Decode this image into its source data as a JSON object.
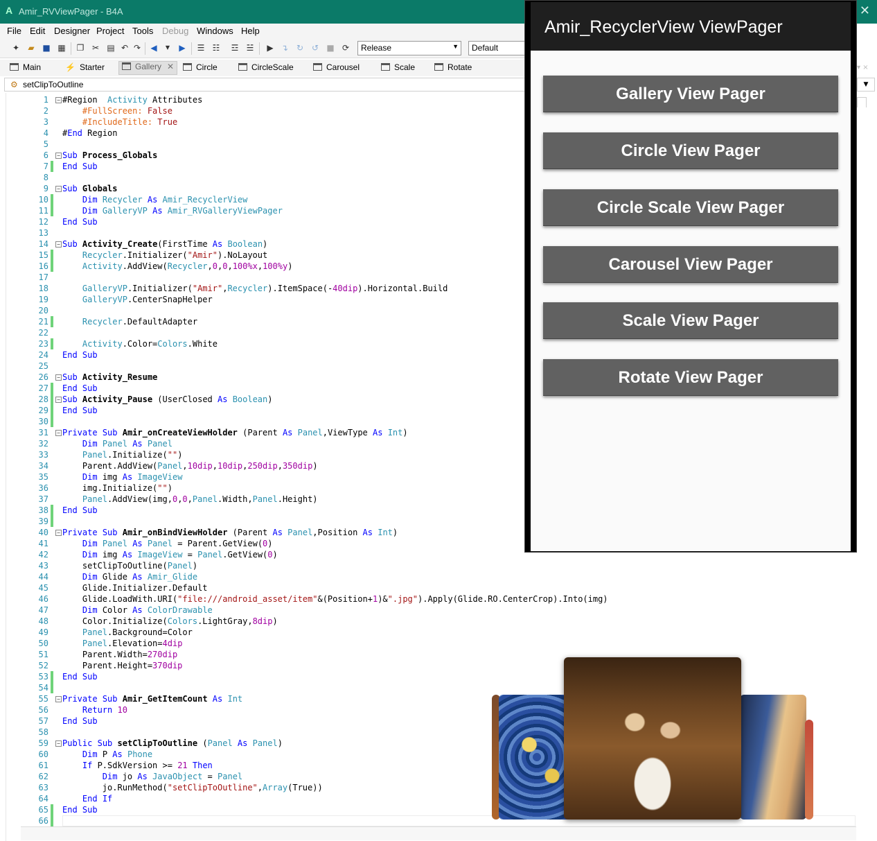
{
  "window": {
    "title": "Amir_RVViewPager - B4A",
    "app_letter": "A",
    "close_glyph": "✕"
  },
  "menu": [
    "File",
    "Edit",
    "Designer",
    "Project",
    "Tools",
    "Debug",
    "Windows",
    "Help"
  ],
  "toolbar": {
    "build_config": "Release",
    "device": "Default"
  },
  "tabs": [
    "Main",
    "Starter",
    "Gallery",
    "Circle",
    "CircleScale",
    "Carousel",
    "Scale",
    "Rotate"
  ],
  "active_tab": "Gallery",
  "subbar": {
    "label": "setClipToOutline"
  },
  "code": {
    "lines": [
      "#Region  Activity Attributes",
      "    #FullScreen: False",
      "    #IncludeTitle: True",
      "#End Region",
      "",
      "Sub Process_Globals",
      "End Sub",
      "",
      "Sub Globals",
      "    Dim Recycler As Amir_RecyclerView",
      "    Dim GalleryVP As Amir_RVGalleryViewPager",
      "End Sub",
      "",
      "Sub Activity_Create(FirstTime As Boolean)",
      "    Recycler.Initializer(\"Amir\").NoLayout",
      "    Activity.AddView(Recycler,0,0,100%x,100%y)",
      "",
      "    GalleryVP.Initializer(\"Amir\",Recycler).ItemSpace(-40dip).Horizontal.Build",
      "    GalleryVP.CenterSnapHelper",
      "",
      "    Recycler.DefaultAdapter",
      "",
      "    Activity.Color=Colors.White",
      "End Sub",
      "",
      "Sub Activity_Resume",
      "End Sub",
      "Sub Activity_Pause (UserClosed As Boolean)",
      "End Sub",
      "",
      "Private Sub Amir_onCreateViewHolder (Parent As Panel,ViewType As Int)",
      "    Dim Panel As Panel",
      "    Panel.Initialize(\"\")",
      "    Parent.AddView(Panel,10dip,10dip,250dip,350dip)",
      "    Dim img As ImageView",
      "    img.Initialize(\"\")",
      "    Panel.AddView(img,0,0,Panel.Width,Panel.Height)",
      "End Sub",
      "",
      "Private Sub Amir_onBindViewHolder (Parent As Panel,Position As Int)",
      "    Dim Panel As Panel = Parent.GetView(0)",
      "    Dim img As ImageView = Panel.GetView(0)",
      "    setClipToOutline(Panel)",
      "    Dim Glide As Amir_Glide",
      "    Glide.Initializer.Default",
      "    Glide.LoadWith.URI(\"file:///android_asset/item\"&(Position+1)&\".jpg\").Apply(Glide.RO.CenterCrop).Into(img)",
      "    Dim Color As ColorDrawable",
      "    Color.Initialize(Colors.LightGray,8dip)",
      "    Panel.Background=Color",
      "    Panel.Elevation=4dip",
      "    Parent.Width=270dip",
      "    Parent.Height=370dip",
      "End Sub",
      "",
      "Private Sub Amir_GetItemCount As Int",
      "    Return 10",
      "End Sub",
      "",
      "Public Sub setClipToOutline (Panel As Panel)",
      "    Dim P As Phone",
      "    If P.SdkVersion >= 21 Then",
      "        Dim jo As JavaObject = Panel",
      "        jo.RunMethod(\"setClipToOutline\",Array(True))",
      "    End If",
      "End Sub",
      ""
    ]
  },
  "phone": {
    "title": "Amir_RecyclerView ViewPager",
    "buttons": [
      "Gallery View Pager",
      "Circle View Pager",
      "Circle Scale View Pager",
      "Carousel View Pager",
      "Scale View Pager",
      "Rotate View Pager"
    ]
  },
  "colors": {
    "titlebar": "#0b7a68",
    "phone_button": "#616161",
    "keyword": "#0000ff",
    "type": "#2b91af",
    "string": "#a31515",
    "number": "#a000a0"
  }
}
